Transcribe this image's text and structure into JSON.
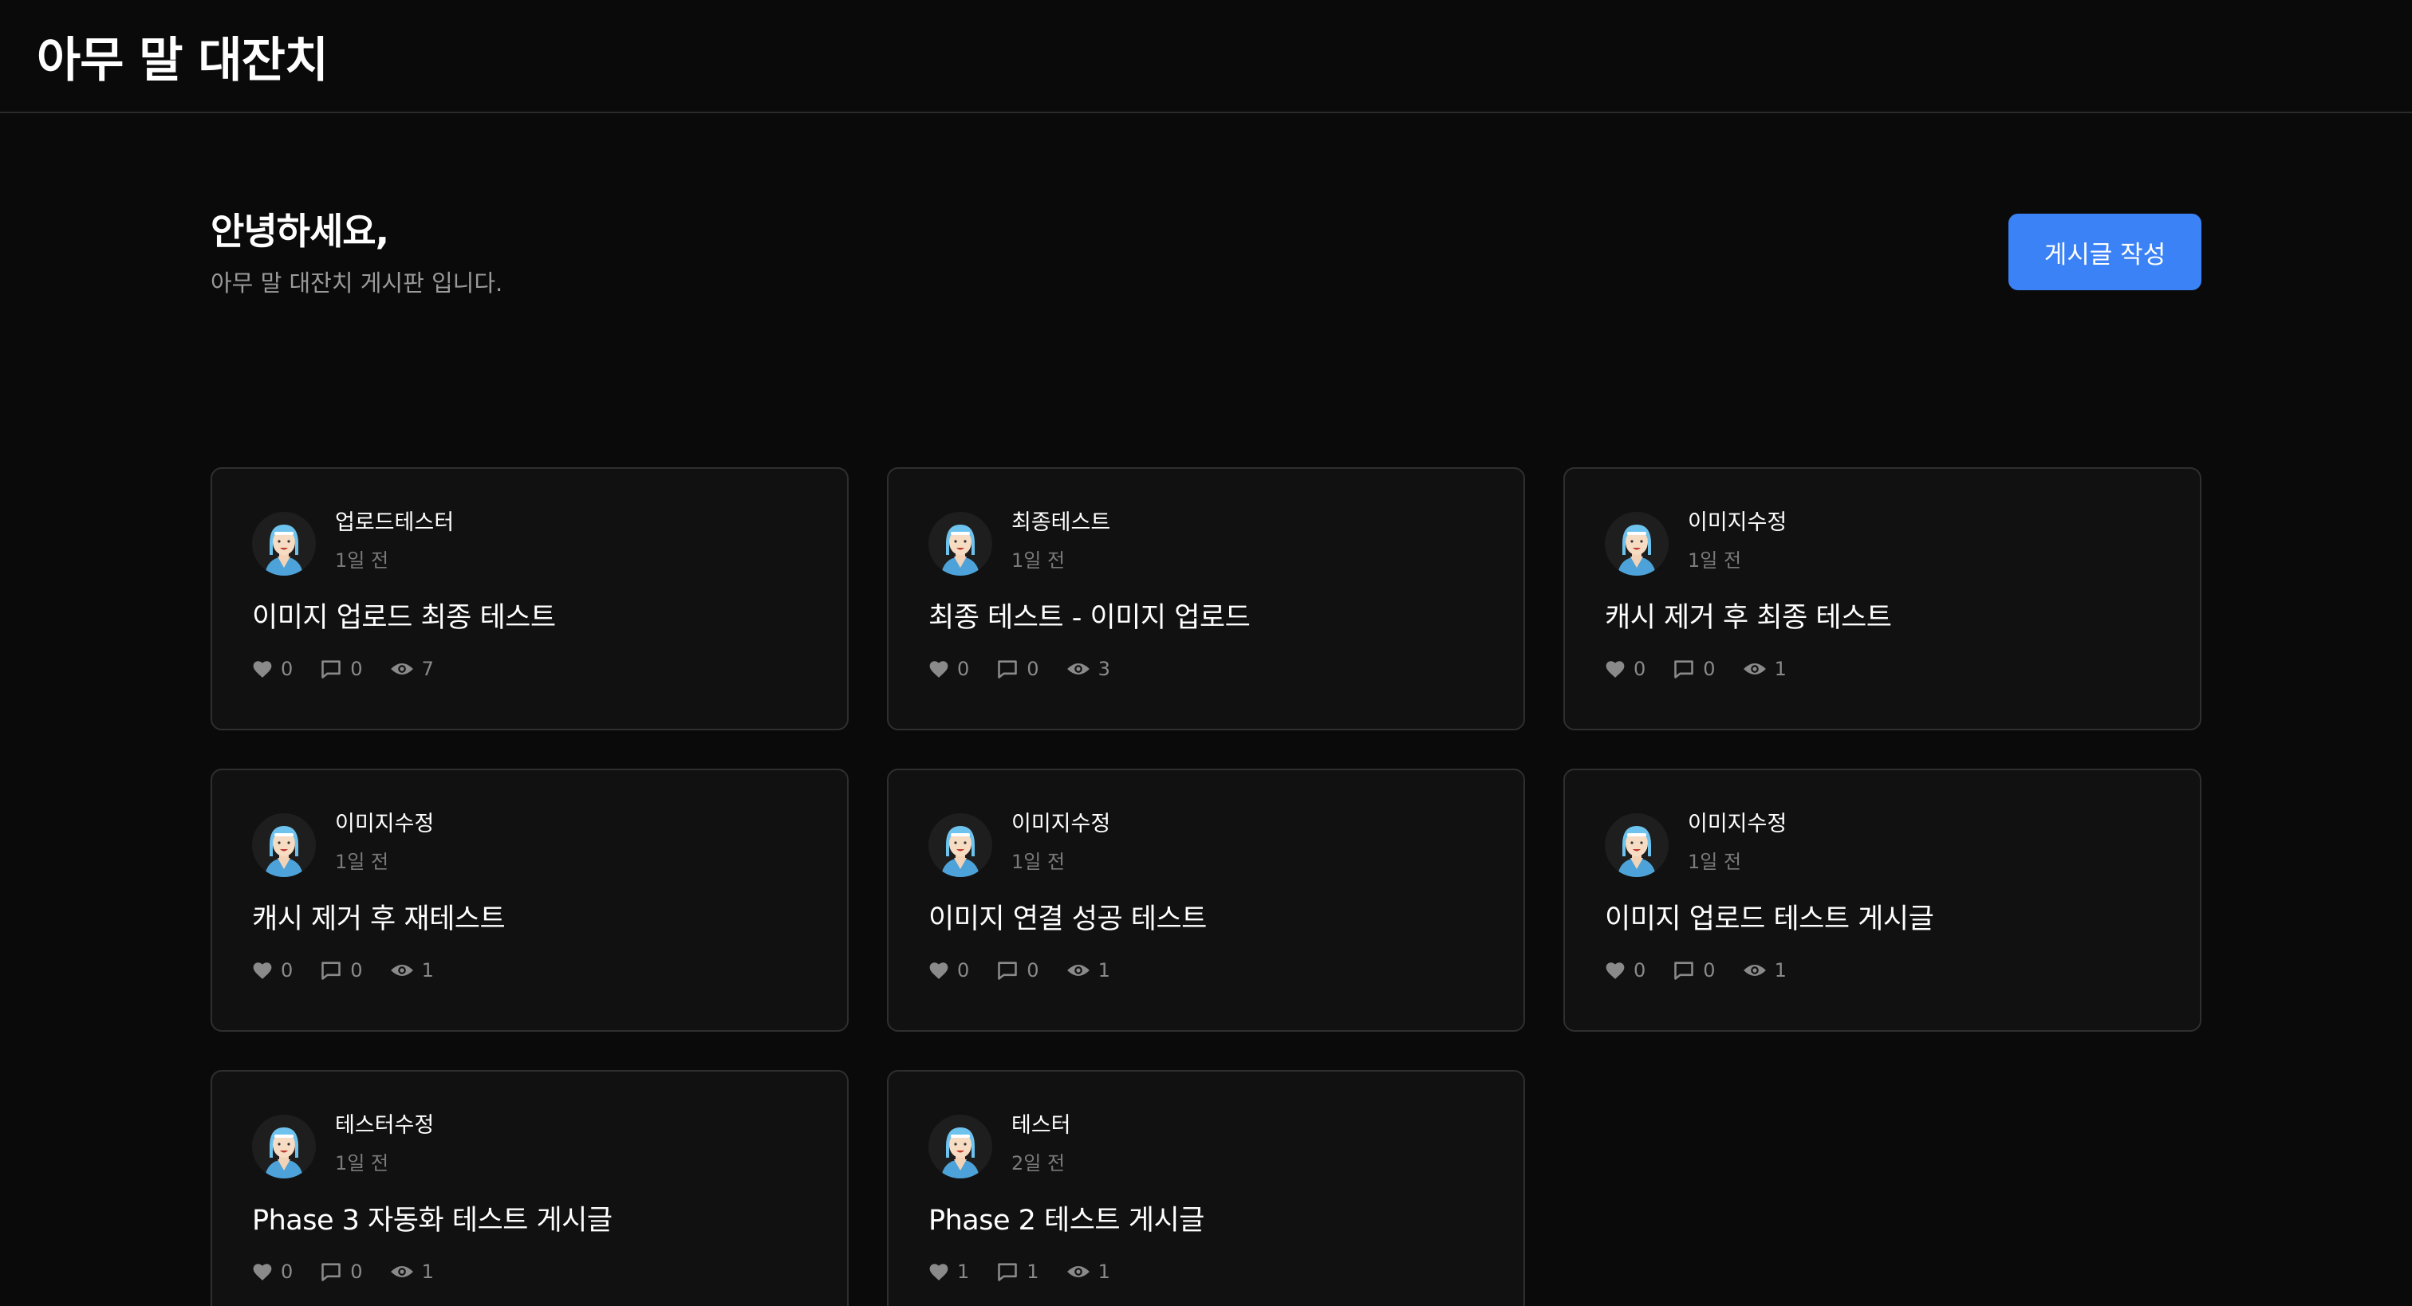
{
  "app": {
    "title": "아무 말 대잔치"
  },
  "hero": {
    "greeting": "안녕하세요,",
    "subtitle": "아무 말 대잔치 게시판 입니다.",
    "write_button": "게시글 작성"
  },
  "colors": {
    "background": "#0a0a0a",
    "card": "#111111",
    "card_border": "#2f2f2f",
    "accent": "#3b82f6",
    "muted": "#8a8a8a"
  },
  "icons": {
    "like": "heart-icon",
    "comment": "comment-icon",
    "view": "eye-icon",
    "avatar": "avatar-icon"
  },
  "posts": [
    {
      "author": "업로드테스터",
      "time": "1일 전",
      "title": "이미지 업로드 최종 테스트",
      "likes": "0",
      "comments": "0",
      "views": "7"
    },
    {
      "author": "최종테스트",
      "time": "1일 전",
      "title": "최종 테스트 - 이미지 업로드",
      "likes": "0",
      "comments": "0",
      "views": "3"
    },
    {
      "author": "이미지수정",
      "time": "1일 전",
      "title": "캐시 제거 후 최종 테스트",
      "likes": "0",
      "comments": "0",
      "views": "1"
    },
    {
      "author": "이미지수정",
      "time": "1일 전",
      "title": "캐시 제거 후 재테스트",
      "likes": "0",
      "comments": "0",
      "views": "1"
    },
    {
      "author": "이미지수정",
      "time": "1일 전",
      "title": "이미지 연결 성공 테스트",
      "likes": "0",
      "comments": "0",
      "views": "1"
    },
    {
      "author": "이미지수정",
      "time": "1일 전",
      "title": "이미지 업로드 테스트 게시글",
      "likes": "0",
      "comments": "0",
      "views": "1"
    },
    {
      "author": "테스터수정",
      "time": "1일 전",
      "title": "Phase 3 자동화 테스트 게시글",
      "likes": "0",
      "comments": "0",
      "views": "1"
    },
    {
      "author": "테스터",
      "time": "2일 전",
      "title": "Phase 2 테스트 게시글",
      "likes": "1",
      "comments": "1",
      "views": "1"
    }
  ]
}
